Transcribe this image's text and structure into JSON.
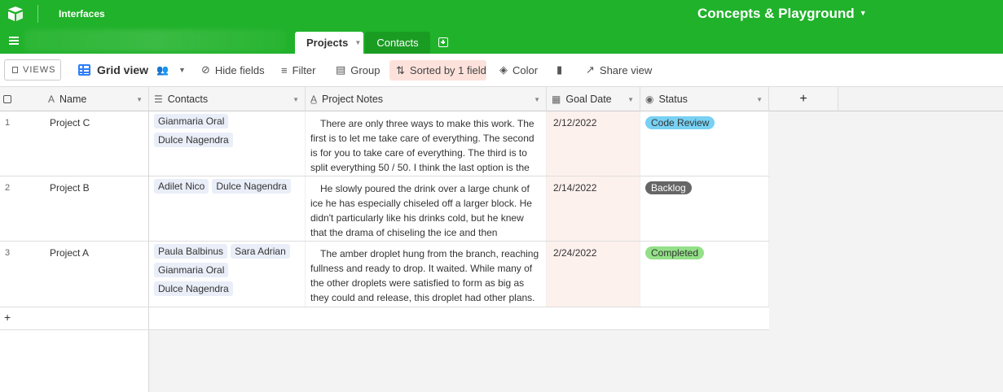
{
  "header": {
    "interfaces_label": "Interfaces",
    "base_title": "Concepts & Playground",
    "tabs": [
      {
        "label": "Projects",
        "active": true
      },
      {
        "label": "Contacts",
        "active": false
      }
    ]
  },
  "toolbar": {
    "views_label": "VIEWS",
    "view_name": "Grid view",
    "hide_fields": "Hide fields",
    "filter": "Filter",
    "group": "Group",
    "sorted": "Sorted by 1 field",
    "color": "Color",
    "share_view": "Share view"
  },
  "columns": {
    "name": "Name",
    "contacts": "Contacts",
    "notes": "Project Notes",
    "goal_date": "Goal Date",
    "status": "Status",
    "add": "+"
  },
  "rows": [
    {
      "num": "1",
      "name": "Project C",
      "contacts": [
        "Gianmaria Oral",
        "Dulce Nagendra"
      ],
      "notes": "There are only three ways to make this work. The first is to let me take care of everything. The second is for you to take care of everything. The third is to split everything 50 / 50. I think the last option is the most…",
      "goal_date": "2/12/2022",
      "status": "Code Review"
    },
    {
      "num": "2",
      "name": "Project B",
      "contacts": [
        "Adilet Nico",
        "Dulce Nagendra"
      ],
      "notes": "He slowly poured the drink over a large chunk of ice he has especially chiseled off a larger block. He didn't particularly like his drinks cold, but he knew that the drama of chiseling the ice and then pouring…",
      "goal_date": "2/14/2022",
      "status": "Backlog"
    },
    {
      "num": "3",
      "name": "Project A",
      "contacts": [
        "Paula Balbinus",
        "Sara Adrian",
        "Gianmaria Oral",
        "Dulce Nagendra"
      ],
      "notes": "The amber droplet hung from the branch, reaching fullness and ready to drop. It waited. While many of the other droplets were satisfied to form as big as they could and release, this droplet had other plans. …",
      "goal_date": "2/24/2022",
      "status": "Completed"
    }
  ],
  "add_row_label": "+",
  "colors": {
    "brand_green": "#20b22a",
    "status_code_review": "#77d1f3",
    "status_backlog": "#666666",
    "status_completed": "#93e088",
    "sorted_bg": "#fde2dc"
  }
}
